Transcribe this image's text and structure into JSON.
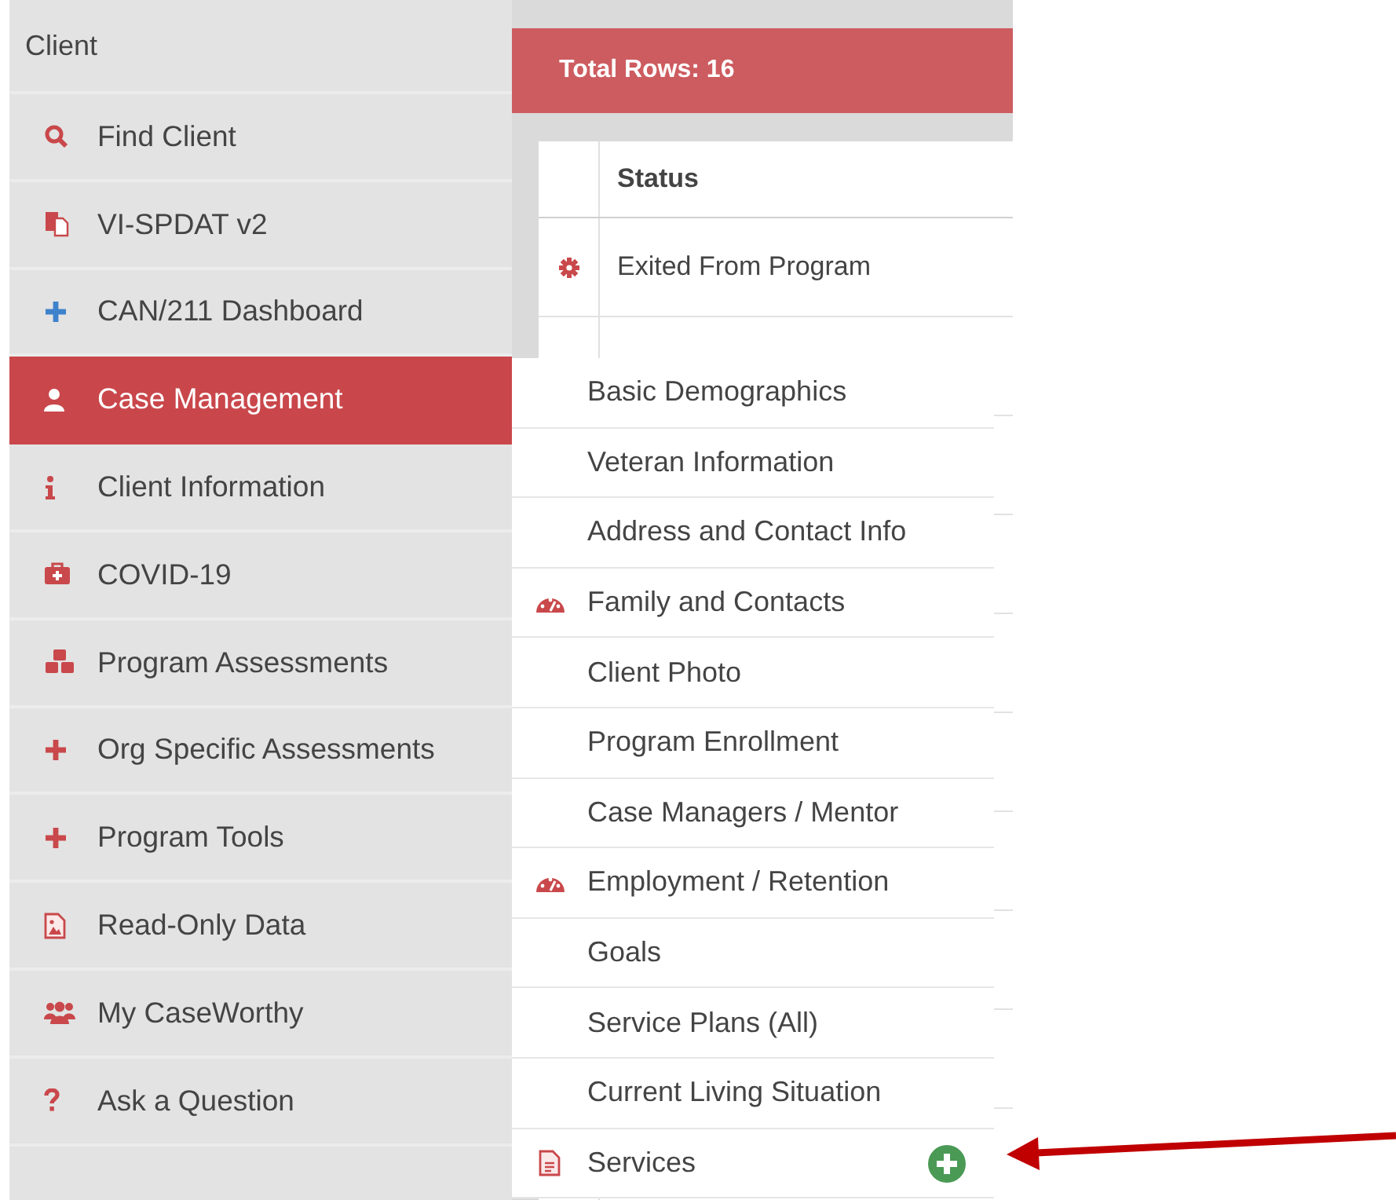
{
  "sidebar": {
    "header": "Client",
    "items": [
      {
        "label": "Find Client",
        "selected": false
      },
      {
        "label": "VI-SPDAT v2",
        "selected": false
      },
      {
        "label": "CAN/211 Dashboard",
        "selected": false
      },
      {
        "label": "Case Management",
        "selected": true
      },
      {
        "label": "Client Information",
        "selected": false
      },
      {
        "label": "COVID-19",
        "selected": false
      },
      {
        "label": "Program Assessments",
        "selected": false
      },
      {
        "label": "Org Specific Assessments",
        "selected": false
      },
      {
        "label": "Program Tools",
        "selected": false
      },
      {
        "label": "Read-Only Data",
        "selected": false
      },
      {
        "label": "My CaseWorthy",
        "selected": false
      },
      {
        "label": "Ask a Question",
        "selected": false
      }
    ]
  },
  "results": {
    "total": "Total Rows: 16",
    "columns": [
      "Status"
    ],
    "rows": [
      {
        "status": "Exited From Program"
      }
    ]
  },
  "submenu": {
    "items": [
      {
        "label": "Basic Demographics"
      },
      {
        "label": "Veteran Information"
      },
      {
        "label": "Address and Contact Info"
      },
      {
        "label": "Family and Contacts"
      },
      {
        "label": "Client Photo"
      },
      {
        "label": "Program Enrollment"
      },
      {
        "label": "Case Managers / Mentor"
      },
      {
        "label": "Employment / Retention"
      },
      {
        "label": "Goals"
      },
      {
        "label": "Service Plans (All)"
      },
      {
        "label": "Current Living Situation"
      },
      {
        "label": "Services",
        "add_button": true
      }
    ]
  }
}
